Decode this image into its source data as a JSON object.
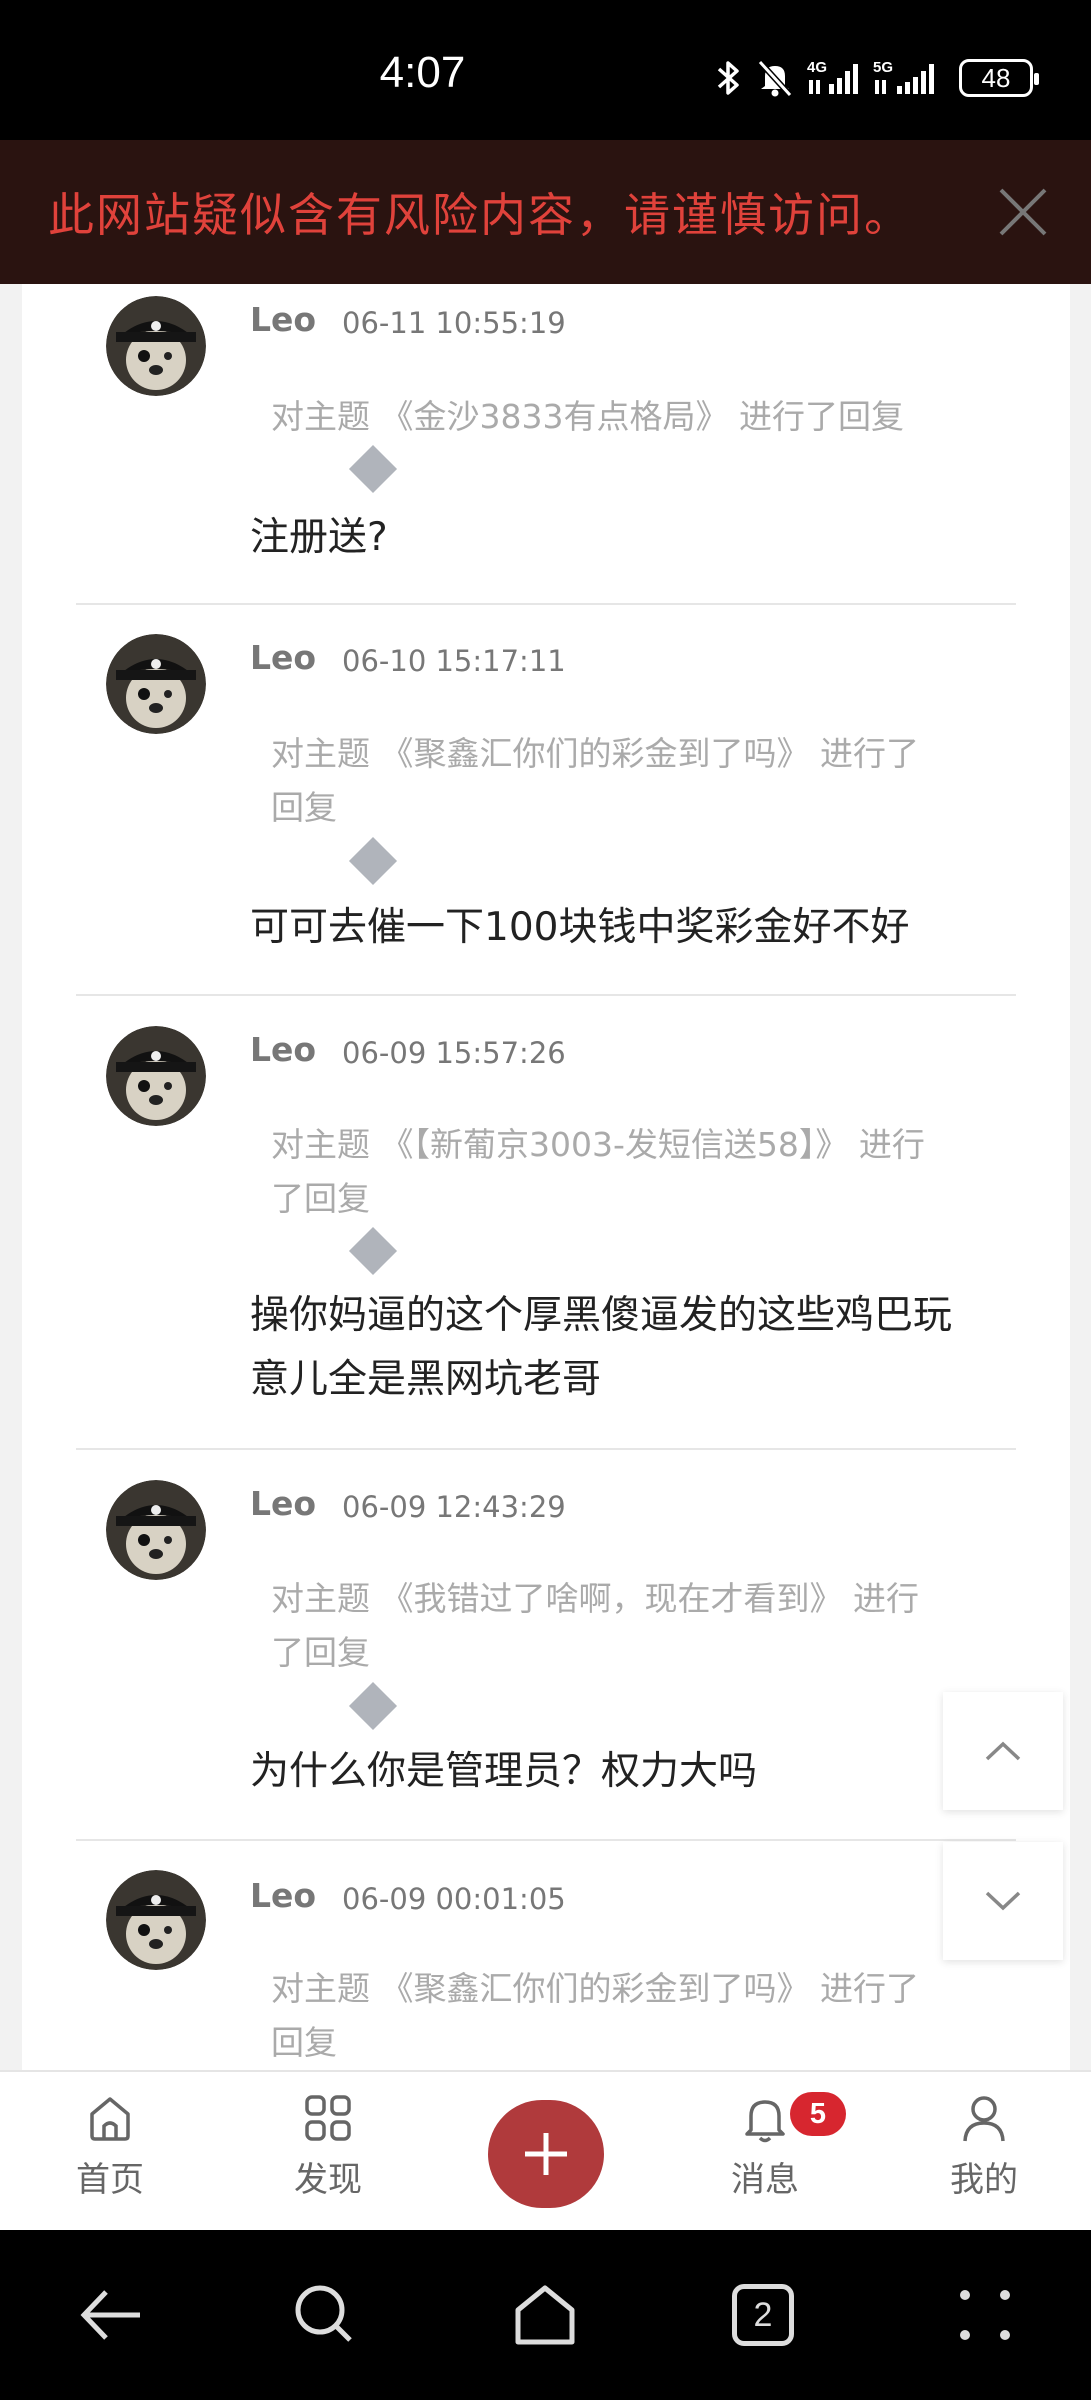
{
  "status_bar": {
    "time": "4:07",
    "battery": "48",
    "icons": [
      "bluetooth-icon",
      "mute-icon",
      "signal-4g-icon",
      "signal-5g-icon",
      "battery-icon"
    ]
  },
  "warning": {
    "text": "此网站疑似含有风险内容，请谨慎访问。",
    "close_icon": "close-icon"
  },
  "replies": [
    {
      "user": "Leo",
      "time": "06-11 10:55:19",
      "topic": "对主题 《金沙3833有点格局》 进行了回复",
      "reply": "注册送?"
    },
    {
      "user": "Leo",
      "time": "06-10 15:17:11",
      "topic": "对主题 《聚鑫汇你们的彩金到了吗》 进行了回复",
      "reply": "可可去催一下100块钱中奖彩金好不好"
    },
    {
      "user": "Leo",
      "time": "06-09 15:57:26",
      "topic": "对主题 《【新葡京3003-发短信送58】》 进行了回复",
      "reply": "操你妈逼的这个厚黑傻逼发的这些鸡巴玩意儿全是黑网坑老哥"
    },
    {
      "user": "Leo",
      "time": "06-09 12:43:29",
      "topic": "对主题 《我错过了啥啊，现在才看到》 进行了回复",
      "reply": "为什么你是管理员？权力大吗"
    },
    {
      "user": "Leo",
      "time": "06-09 00:01:05",
      "topic": "对主题 《聚鑫汇你们的彩金到了吗》 进行了回复",
      "reply": ""
    }
  ],
  "tabbar": {
    "home": "首页",
    "discover": "发现",
    "messages": "消息",
    "messages_badge": "5",
    "profile": "我的"
  },
  "navbar": {
    "tabs_count": "2"
  },
  "colors": {
    "accent": "#b03a3c",
    "warning_text": "#e0423b",
    "warning_bg": "#2a1310",
    "badge": "#d7262f"
  }
}
